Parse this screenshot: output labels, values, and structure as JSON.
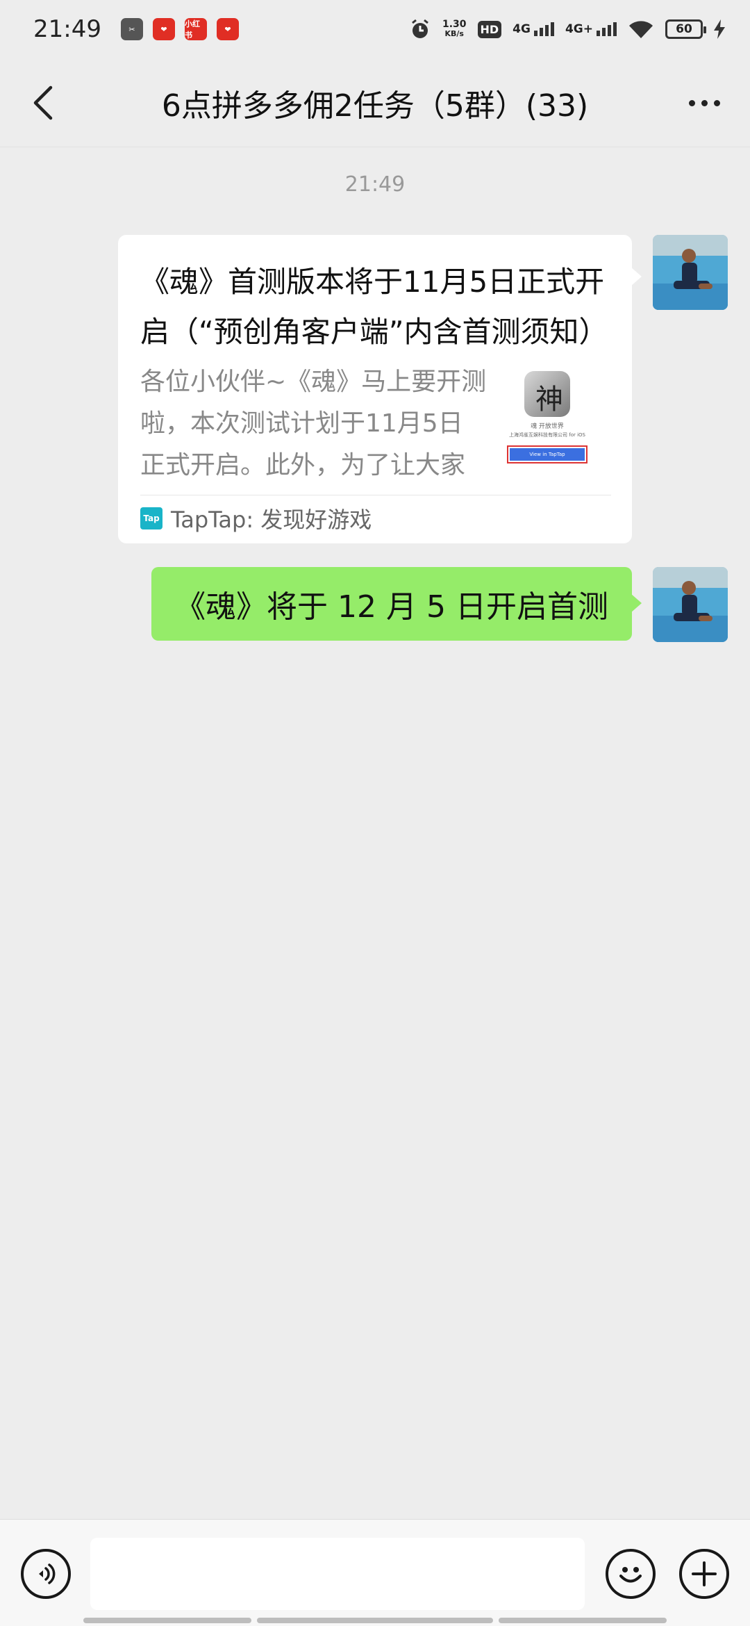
{
  "status_bar": {
    "time": "21:49",
    "notification_icons": [
      "scissors-app-icon",
      "pinduoduo-icon",
      "xiaohongshu-icon",
      "pinduoduo-icon"
    ],
    "xiaohongshu_label": "小红书",
    "speed_value": "1.30",
    "speed_unit": "KB/s",
    "hd_label": "HD",
    "network1": "4G",
    "network2": "4G+",
    "battery": "60"
  },
  "nav": {
    "title": "6点拼多多佣2任务（5群）(33)"
  },
  "chat": {
    "timestamp": "21:49",
    "messages": [
      {
        "type": "link_card",
        "title": "《魂》首测版本将于11月5日正式开启（“预创角客户端”内含首测须知）",
        "description": "各位小伙伴~《魂》马上要开测啦，本次测试计划于11月5日正式开启。此外，为了让大家",
        "thumb_glyph": "神",
        "thumb_caption": "魂 开放世界",
        "thumb_caption2": "上海鸿雀互娱科技有限公司 for iOS",
        "thumb_button": "View in TapTap",
        "source_logo": "Tap",
        "source": "TapTap: 发现好游戏"
      },
      {
        "type": "text",
        "text": "《魂》将于 12 月 5 日开启首测"
      }
    ]
  },
  "input_bar": {
    "placeholder": ""
  },
  "colors": {
    "background": "#ededed",
    "sent_bubble": "#95ec69",
    "card": "#ffffff",
    "taptap": "#19b4c8"
  }
}
